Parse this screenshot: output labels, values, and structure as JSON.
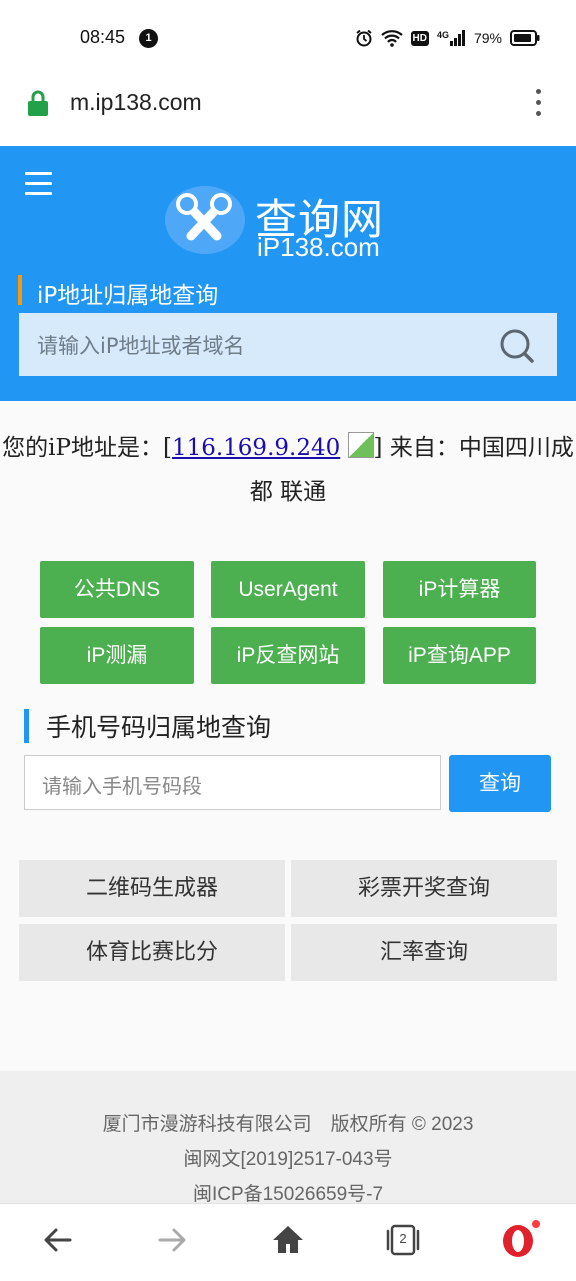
{
  "status_bar": {
    "time": "08:45",
    "notification_count": "1",
    "hd_label": "HD",
    "network": "4G",
    "battery": "79%"
  },
  "browser": {
    "url": "m.ip138.com",
    "tab_count": "2"
  },
  "header": {
    "logo_title": "查询网",
    "logo_subtitle": "iP138.com",
    "ip_section_label": "iP地址归属地查询",
    "ip_search_placeholder": "请输入iP地址或者域名"
  },
  "ip_result": {
    "prefix": "您的iP地址是：[",
    "ip": "116.169.9.240",
    "suffix": "] 来自：中国四川成都 联通"
  },
  "tool_buttons": [
    {
      "label": "公共DNS"
    },
    {
      "label": "UserAgent"
    },
    {
      "label": "iP计算器"
    },
    {
      "label": "iP测漏"
    },
    {
      "label": "iP反查网站"
    },
    {
      "label": "iP查询APP"
    }
  ],
  "phone_lookup": {
    "title": "手机号码归属地查询",
    "placeholder": "请输入手机号码段",
    "button": "查询"
  },
  "more_links": [
    {
      "label": "二维码生成器"
    },
    {
      "label": "彩票开奖查询"
    },
    {
      "label": "体育比赛比分"
    },
    {
      "label": "汇率查询"
    }
  ],
  "footer": {
    "company": "厦门市漫游科技有限公司　版权所有 © 2023",
    "license": "闽网文[2019]2517-043号",
    "icp": "闽ICP备15026659号-7"
  },
  "colors": {
    "header_blue": "#2196f3",
    "button_green": "#4caf50",
    "accent_orange": "#ff9800"
  }
}
